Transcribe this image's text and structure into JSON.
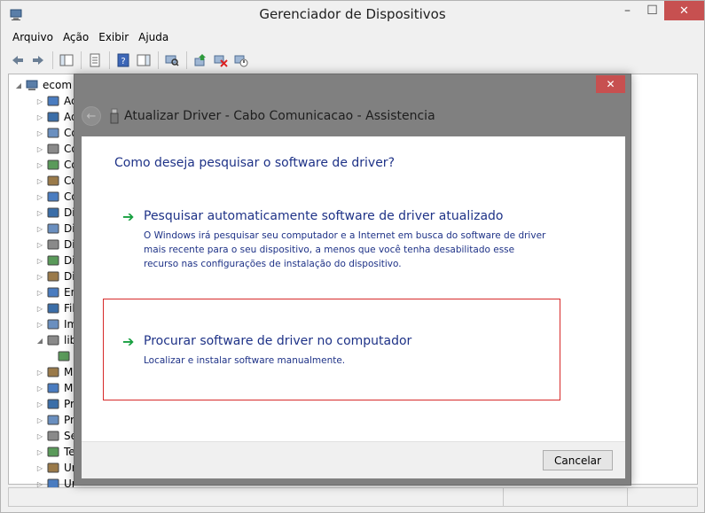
{
  "window": {
    "title": "Gerenciador de Dispositivos",
    "min_glyph": "–",
    "max_glyph": "☐",
    "close_glyph": "✕"
  },
  "menu": [
    "Arquivo",
    "Ação",
    "Exibir",
    "Ajuda"
  ],
  "tree": {
    "root": "ecom",
    "items": [
      {
        "label": "Ac",
        "icon": "audio-input-icon"
      },
      {
        "label": "Ad",
        "icon": "display-adapter-icon"
      },
      {
        "label": "Co",
        "icon": "computer-icon"
      },
      {
        "label": "Co",
        "icon": "network-controller-icon"
      },
      {
        "label": "Co",
        "icon": "sound-controller-icon"
      },
      {
        "label": "Co",
        "icon": "storage-controller-icon"
      },
      {
        "label": "Co",
        "icon": "usb-controller-icon"
      },
      {
        "label": "Di",
        "icon": "disk-drive-icon"
      },
      {
        "label": "Di",
        "icon": "imaging-device-icon"
      },
      {
        "label": "Di",
        "icon": "display-device-icon"
      },
      {
        "label": "Di",
        "icon": "dvd-drive-icon"
      },
      {
        "label": "Di",
        "icon": "generic-device-icon"
      },
      {
        "label": "En",
        "icon": "input-output-icon"
      },
      {
        "label": "Fil",
        "icon": "print-queue-icon"
      },
      {
        "label": "Im",
        "icon": "printer-icon"
      },
      {
        "label": "lib",
        "icon": "usb-library-icon"
      },
      {
        "label": "",
        "icon": "usb-device-icon"
      },
      {
        "label": "M",
        "icon": "monitor-icon"
      },
      {
        "label": "M",
        "icon": "mouse-icon"
      },
      {
        "label": "Pr",
        "icon": "processor-icon"
      },
      {
        "label": "Pr",
        "icon": "processor-icon"
      },
      {
        "label": "Se",
        "icon": "software-device-icon"
      },
      {
        "label": "Te",
        "icon": "keyboard-icon"
      },
      {
        "label": "Ur",
        "icon": "storage-volume-icon"
      },
      {
        "label": "Ur",
        "icon": "usb-hub-icon"
      }
    ]
  },
  "dialog": {
    "close_glyph": "✕",
    "back_glyph": "←",
    "title": "Atualizar Driver -  Cabo Comunicacao - Assistencia",
    "question": "Como deseja pesquisar o software de driver?",
    "option_auto": {
      "arrow": "➔",
      "title": "Pesquisar automaticamente software de driver atualizado",
      "description": "O Windows irá pesquisar seu computador e a Internet em busca do software de driver mais recente para o seu dispositivo, a menos que você tenha desabilitado esse recurso nas configurações de instalação do dispositivo."
    },
    "option_manual": {
      "arrow": "➔",
      "title": "Procurar software de driver no computador",
      "description": "Localizar e instalar software manualmente."
    },
    "cancel_label": "Cancelar"
  },
  "colors": {
    "link_blue": "#1e3287",
    "arrow_green": "#18a040",
    "highlight_red": "#d72a2a",
    "close_red": "#c75050"
  }
}
